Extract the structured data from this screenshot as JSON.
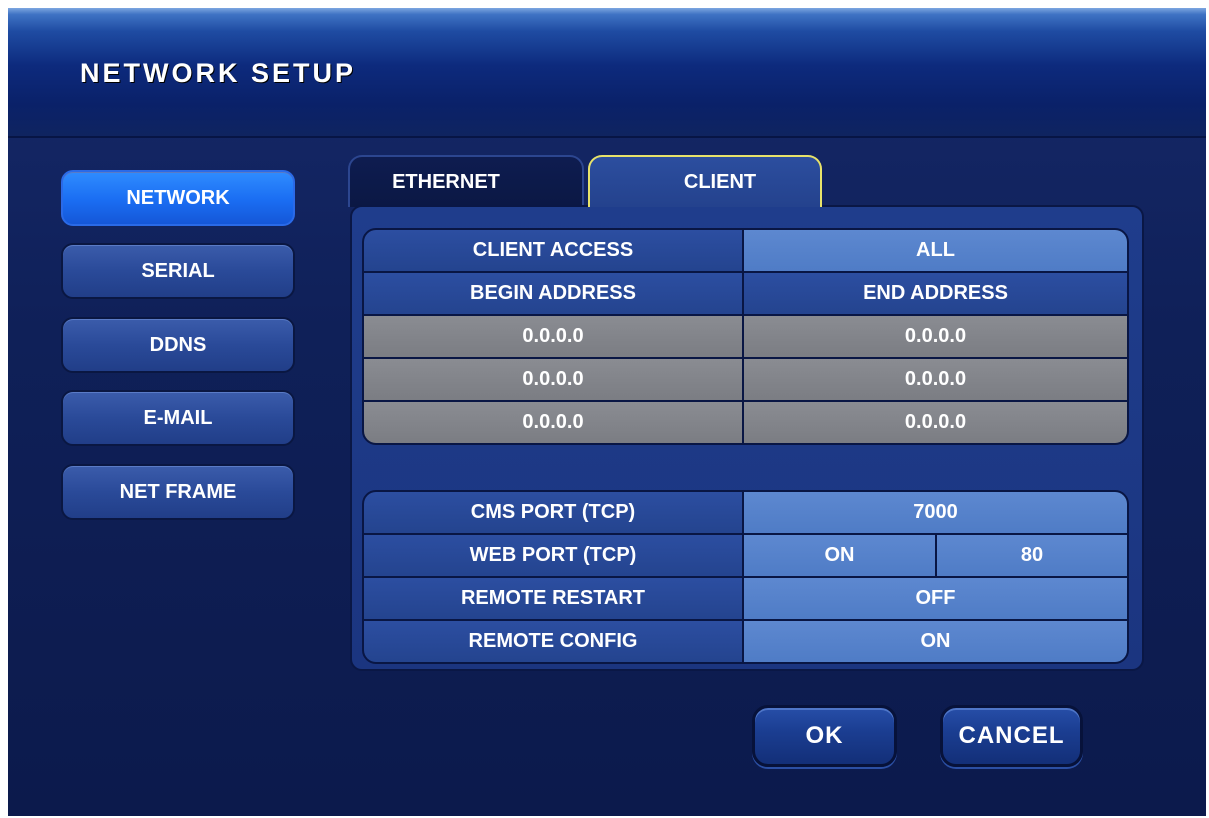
{
  "window": {
    "title": "NETWORK SETUP"
  },
  "sidebar": {
    "items": [
      {
        "label": "NETWORK",
        "active": true
      },
      {
        "label": "SERIAL",
        "active": false
      },
      {
        "label": "DDNS",
        "active": false
      },
      {
        "label": "E-MAIL",
        "active": false
      },
      {
        "label": "NET FRAME",
        "active": false
      }
    ]
  },
  "tabs": [
    {
      "label": "ETHERNET",
      "active": false
    },
    {
      "label": "CLIENT",
      "active": true
    }
  ],
  "client_access": {
    "label": "CLIENT ACCESS",
    "value": "ALL",
    "begin_header": "BEGIN ADDRESS",
    "end_header": "END ADDRESS",
    "ranges": [
      {
        "begin": "0.0.0.0",
        "end": "0.0.0.0"
      },
      {
        "begin": "0.0.0.0",
        "end": "0.0.0.0"
      },
      {
        "begin": "0.0.0.0",
        "end": "0.0.0.0"
      }
    ]
  },
  "ports": {
    "cms_label": "CMS PORT (TCP)",
    "cms_value": "7000",
    "web_label": "WEB PORT (TCP)",
    "web_state": "ON",
    "web_port": "80",
    "restart_label": "REMOTE RESTART",
    "restart_value": "OFF",
    "config_label": "REMOTE CONFIG",
    "config_value": "ON"
  },
  "buttons": {
    "ok": "OK",
    "cancel": "CANCEL"
  },
  "colors": {
    "active_nav": "#1a6df2",
    "active_tab_border": "#e8e36a",
    "disabled_cell": "#7b7d83"
  }
}
